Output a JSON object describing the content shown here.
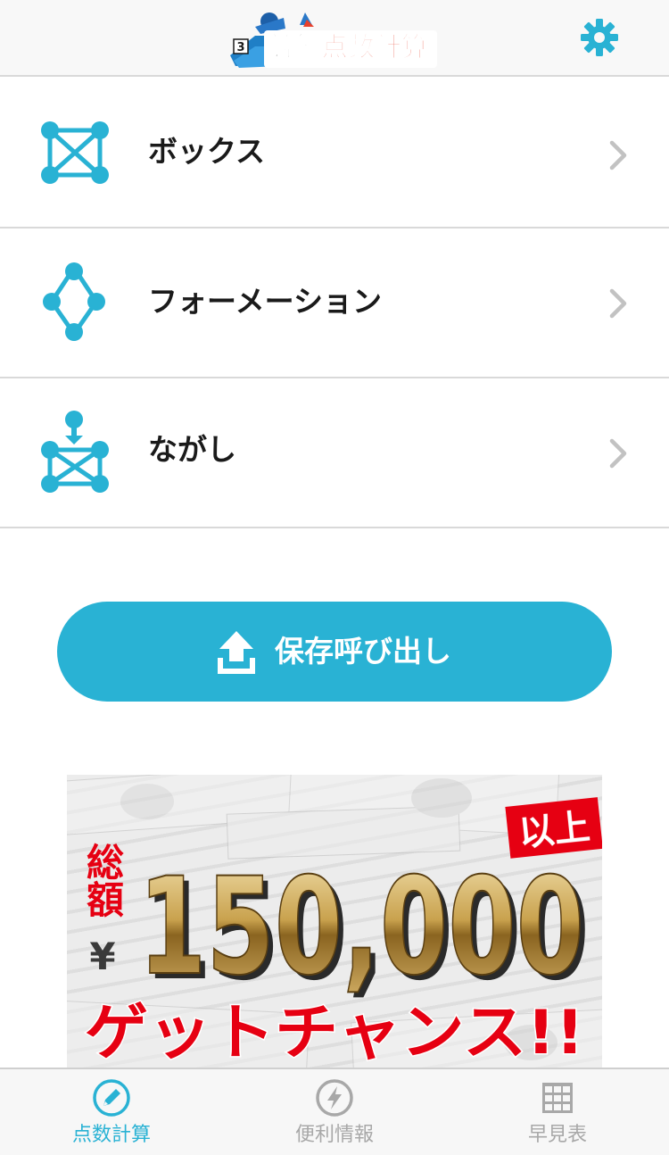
{
  "header": {
    "logo": {
      "part1": "競艇",
      "part2": "点数計算",
      "badge_number": "3"
    },
    "settings_icon": "gear-icon"
  },
  "colors": {
    "accent": "#29b2d4",
    "tab_active": "#29b2d4",
    "tab_inactive": "#a8a8a8",
    "divider": "#d9d9d9",
    "ad_red": "#e60012",
    "ad_gold": "#b8923a"
  },
  "menu": {
    "items": [
      {
        "label": "ボックス",
        "icon": "box-network-icon"
      },
      {
        "label": "フォーメーション",
        "icon": "formation-diamond-icon"
      },
      {
        "label": "ながし",
        "icon": "nagashi-network-icon"
      }
    ]
  },
  "load_button": {
    "label": "保存呼び出し",
    "icon": "upload-icon"
  },
  "ad": {
    "vertical_left": "総額",
    "currency": "¥",
    "amount": "150,000",
    "badge": "以上",
    "tagline": "ゲットチャンス!!"
  },
  "tabs": [
    {
      "label": "点数計算",
      "icon": "pencil-icon",
      "active": true
    },
    {
      "label": "便利情報",
      "icon": "lightning-icon",
      "active": false
    },
    {
      "label": "早見表",
      "icon": "grid-table-icon",
      "active": false
    }
  ]
}
